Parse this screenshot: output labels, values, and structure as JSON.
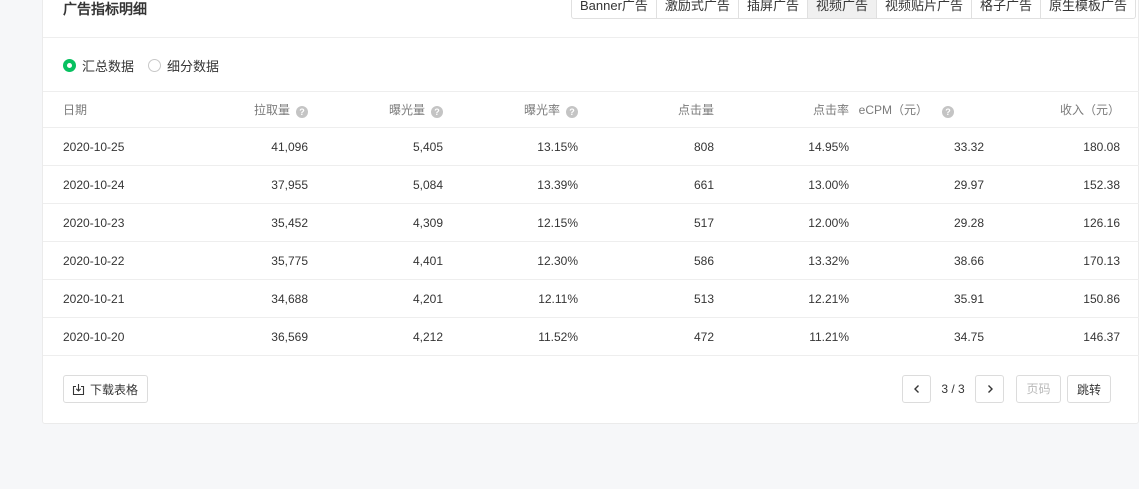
{
  "card": {
    "title": "广告指标明细"
  },
  "tabs": [
    {
      "label": "Banner广告",
      "active": false
    },
    {
      "label": "激励式广告",
      "active": false
    },
    {
      "label": "插屏广告",
      "active": false
    },
    {
      "label": "视频广告",
      "active": true
    },
    {
      "label": "视频贴片广告",
      "active": false
    },
    {
      "label": "格子广告",
      "active": false
    },
    {
      "label": "原生模板广告",
      "active": false
    }
  ],
  "radio": {
    "summary_label": "汇总数据",
    "detail_label": "细分数据",
    "selected": "summary",
    "accent_color": "#07c160"
  },
  "table": {
    "columns": [
      {
        "label": "日期",
        "help": false
      },
      {
        "label": "拉取量",
        "help": true
      },
      {
        "label": "曝光量",
        "help": true
      },
      {
        "label": "曝光率",
        "help": true
      },
      {
        "label": "点击量",
        "help": false
      },
      {
        "label": "点击率",
        "help": false
      },
      {
        "label": "eCPM（元）",
        "help": true
      },
      {
        "label": "收入（元）",
        "help": false
      }
    ],
    "rows": [
      [
        "2020-10-25",
        "41,096",
        "5,405",
        "13.15%",
        "808",
        "14.95%",
        "33.32",
        "180.08"
      ],
      [
        "2020-10-24",
        "37,955",
        "5,084",
        "13.39%",
        "661",
        "13.00%",
        "29.97",
        "152.38"
      ],
      [
        "2020-10-23",
        "35,452",
        "4,309",
        "12.15%",
        "517",
        "12.00%",
        "29.28",
        "126.16"
      ],
      [
        "2020-10-22",
        "35,775",
        "4,401",
        "12.30%",
        "586",
        "13.32%",
        "38.66",
        "170.13"
      ],
      [
        "2020-10-21",
        "34,688",
        "4,201",
        "12.11%",
        "513",
        "12.21%",
        "35.91",
        "150.86"
      ],
      [
        "2020-10-20",
        "36,569",
        "4,212",
        "11.52%",
        "472",
        "11.21%",
        "34.75",
        "146.37"
      ]
    ]
  },
  "footer": {
    "download_label": "下载表格",
    "page_indicator": "3 / 3",
    "page_input_placeholder": "页码",
    "jump_label": "跳转"
  },
  "icons": {
    "help": "question-circle-icon",
    "download": "download-icon",
    "prev": "chevron-left-icon",
    "next": "chevron-right-icon"
  }
}
